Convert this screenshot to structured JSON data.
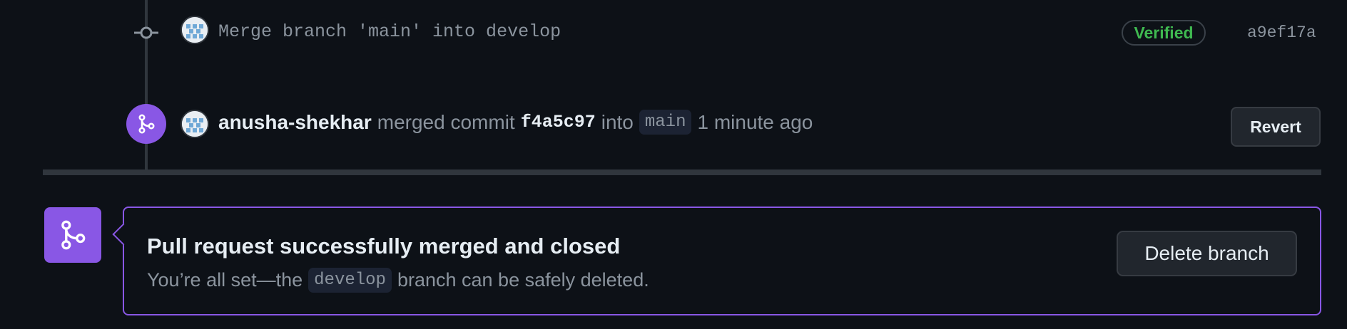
{
  "commit": {
    "message": "Merge branch 'main' into develop",
    "verified_label": "Verified",
    "sha": "a9ef17a"
  },
  "merge_event": {
    "user": "anusha-shekhar",
    "action_text": "merged commit",
    "commit_sha": "f4a5c97",
    "into_text": "into",
    "base_branch": "main",
    "time": "1 minute ago",
    "revert_label": "Revert"
  },
  "status": {
    "title": "Pull request successfully merged and closed",
    "sub_before": "You’re all set—the",
    "branch": "develop",
    "sub_after": "branch can be safely deleted.",
    "delete_label": "Delete branch"
  },
  "colors": {
    "background": "#0d1117",
    "merged_purple": "#8957e5",
    "verified_green": "#3fb950",
    "muted_text": "#8b949e"
  },
  "icons": {
    "commit": "git-commit-icon",
    "merge": "git-merge-icon",
    "avatar": "identicon-avatar"
  }
}
